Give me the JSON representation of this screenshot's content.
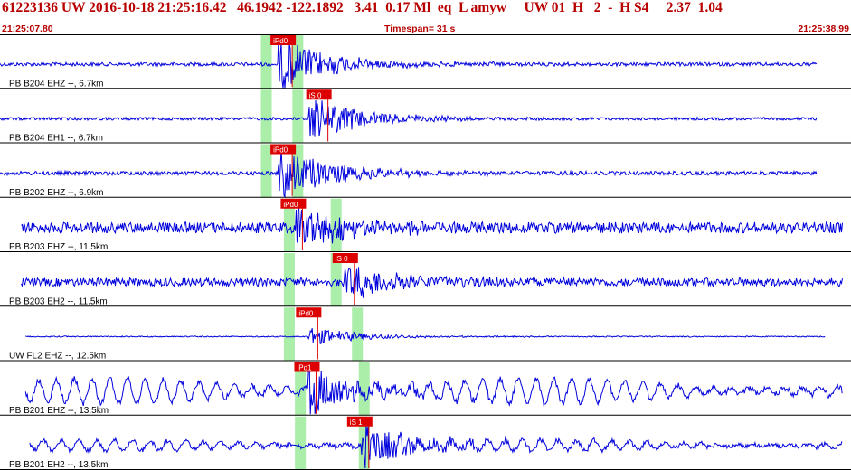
{
  "header": {
    "event_line": "61223136 UW 2016-10-18 21:25:16.42   46.1942 -122.1892   3.41  0.17 Ml  eq  L amyw     UW 01  H   2  -  H S4     2.37  1.04",
    "start_time": "21:25:07.80",
    "timespan": "Timespan=  31 s",
    "end_time": "21:25:38.99"
  },
  "colors": {
    "header_text": "#b80000",
    "trace": "#0000dd",
    "pick_flag": "#dd0000",
    "pick_window": "#aaeeaa",
    "divider": "#000000"
  },
  "channels": [
    {
      "label": "PB B204 EHZ --, 6.7km",
      "amp": 7,
      "start": 0.0,
      "end": 0.96,
      "noise": 2.0,
      "low": 0.0,
      "picks": [
        {
          "text": "iPd0",
          "x": 0.32
        }
      ],
      "windows": [
        0.313,
        0.35
      ],
      "event_x": 0.327,
      "burst": 28
    },
    {
      "label": "PB B204 EH1 --, 6.7km",
      "amp": 6,
      "start": 0.0,
      "end": 0.96,
      "noise": 1.6,
      "low": 0.0,
      "picks": [
        {
          "text": "iS 0",
          "x": 0.362
        }
      ],
      "windows": [
        0.313,
        0.35
      ],
      "event_x": 0.362,
      "burst": 24
    },
    {
      "label": "PB B202 EHZ --, 6.9km",
      "amp": 8,
      "start": 0.0,
      "end": 0.96,
      "noise": 2.2,
      "low": 0.0,
      "picks": [
        {
          "text": "iPd0",
          "x": 0.32
        }
      ],
      "windows": [
        0.313,
        0.35
      ],
      "event_x": 0.327,
      "burst": 28
    },
    {
      "label": "PB B203 EHZ --, 11.5km",
      "amp": 12,
      "start": 0.025,
      "end": 0.99,
      "noise": 6.0,
      "low": 0.0,
      "picks": [
        {
          "text": "iPd0",
          "x": 0.332
        }
      ],
      "windows": [
        0.34,
        0.395
      ],
      "event_x": 0.348,
      "burst": 24
    },
    {
      "label": "PB B203 EH2 --, 11.5km",
      "amp": 10,
      "start": 0.025,
      "end": 0.99,
      "noise": 4.5,
      "low": 0.0,
      "picks": [
        {
          "text": "iS 0",
          "x": 0.393
        }
      ],
      "windows": [
        0.34,
        0.395
      ],
      "event_x": 0.405,
      "burst": 18
    },
    {
      "label": "UW FL2 EHZ --, 12.5km",
      "amp": 2,
      "start": 0.03,
      "end": 0.97,
      "noise": 0.6,
      "low": 0.0,
      "picks": [
        {
          "text": "iPd0",
          "x": 0.35
        }
      ],
      "windows": [
        0.34,
        0.42
      ],
      "event_x": 0.362,
      "burst": 10
    },
    {
      "label": "PB B201 EHZ --, 13.5km",
      "amp": 12,
      "start": 0.03,
      "end": 0.99,
      "noise": 3.0,
      "low": 14.0,
      "picks": [
        {
          "text": "iPd1",
          "x": 0.348
        }
      ],
      "windows": [
        0.353,
        0.428
      ],
      "event_x": 0.362,
      "burst": 24
    },
    {
      "label": "PB B201 EH2 --, 13.5km",
      "amp": 8,
      "start": 0.035,
      "end": 0.99,
      "noise": 2.5,
      "low": 6.0,
      "picks": [
        {
          "text": "iS 1",
          "x": 0.41
        }
      ],
      "windows": [
        0.353,
        0.428
      ],
      "event_x": 0.425,
      "burst": 24
    }
  ]
}
